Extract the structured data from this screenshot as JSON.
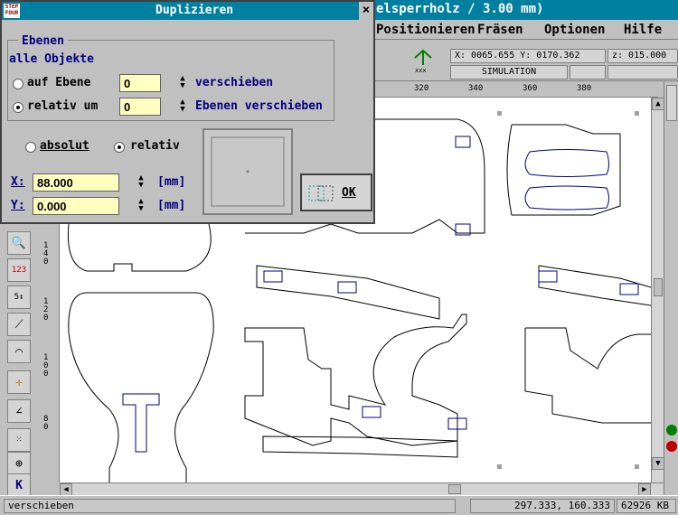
{
  "app": {
    "title": "elsperrholz / 3.00 mm)",
    "menu": [
      "Positionieren",
      "Fräsen",
      "Optionen",
      "Hilfe"
    ],
    "coords_readout": "X: 0065.655 Y: 0170.362",
    "z_readout": "z: 015.000",
    "mode": "SIMULATION",
    "ruler_ticks": [
      "320",
      "340",
      "360",
      "380"
    ],
    "left_ruler": [
      "1 4 0",
      "1 2 0",
      "1 0 0",
      "8 0"
    ],
    "status": {
      "message": "verschieben",
      "position": "297.333,   160.333",
      "memory": "62926 KB"
    }
  },
  "dialog": {
    "title": "Duplizieren",
    "close": "×",
    "logo": "STEP FOUR",
    "group_label": "Ebenen",
    "all_objects": "alle Objekte",
    "opt_abs_level": "auf Ebene",
    "abs_level_value": "0",
    "abs_level_suffix": "verschieben",
    "opt_rel_level": "relativ um",
    "rel_level_value": "0",
    "rel_level_suffix": "Ebenen verschieben",
    "mode_absolut": "absolut",
    "mode_relativ": "relativ",
    "x_label": "X:",
    "x_value": "88.000",
    "x_unit": "[mm]",
    "y_label": "Y:",
    "y_value": "0.000",
    "y_unit": "[mm]",
    "ok": "OK"
  }
}
